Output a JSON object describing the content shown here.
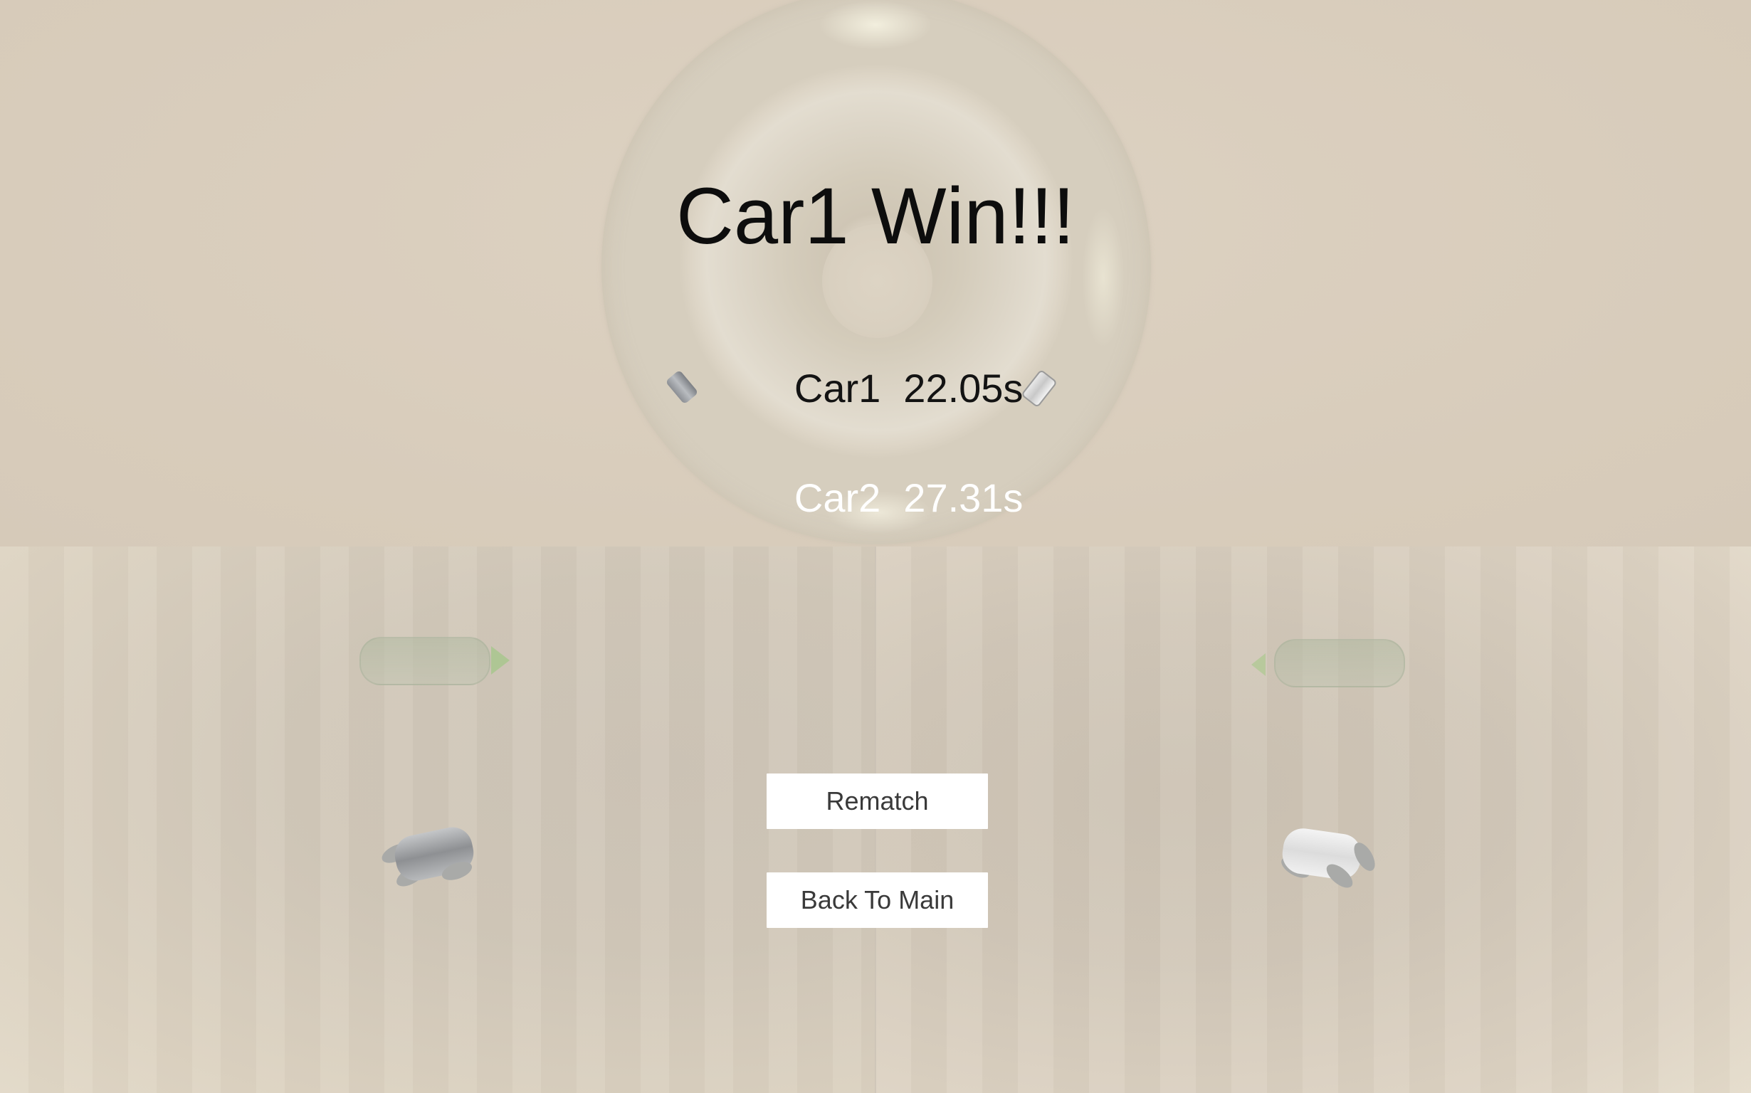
{
  "result": {
    "title": "Car1 Win!!!",
    "times": [
      {
        "name": "Car1",
        "time": "22.05s",
        "color": "#131313"
      },
      {
        "name": "Car2",
        "time": "27.31s",
        "color": "#ffffff"
      }
    ]
  },
  "buttons": {
    "rematch_label": "Rematch",
    "back_label": "Back To Main"
  },
  "scene": {
    "track_color": "#ddd6c8",
    "background_color": "#d9cdbd",
    "car1_color": "#8e9093",
    "car2_color": "#f0f0f0"
  }
}
